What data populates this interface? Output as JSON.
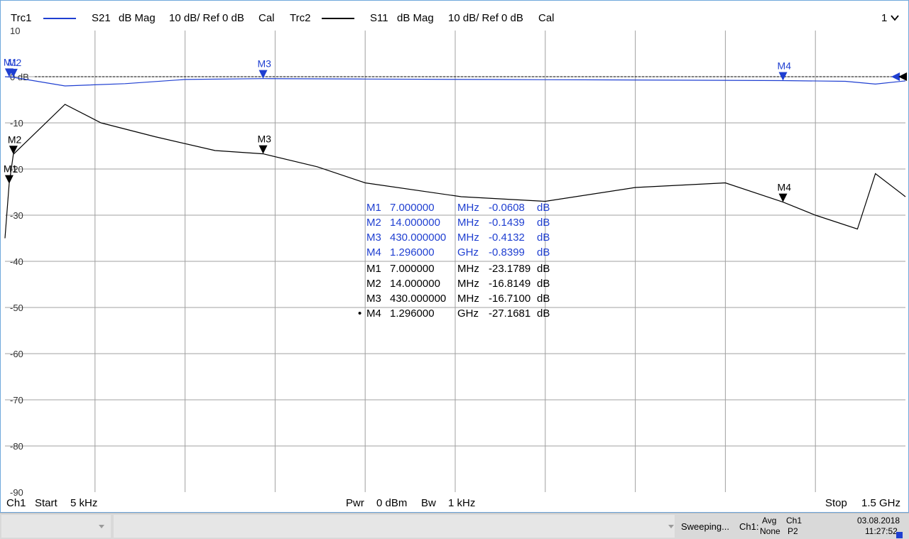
{
  "header": {
    "trc1": {
      "name": "Trc1",
      "param": "S21",
      "format": "dB Mag",
      "scale": "10 dB/ Ref 0 dB",
      "cal": "Cal",
      "color": "#1f3fd1"
    },
    "trc2": {
      "name": "Trc2",
      "param": "S11",
      "format": "dB Mag",
      "scale": "10 dB/ Ref 0 dB",
      "cal": "Cal",
      "color": "#000000"
    },
    "window_number": "1",
    "window_icon": "chevron-down-icon"
  },
  "axis": {
    "y_ticks": [
      "10",
      "0 dB",
      "-10",
      "-20",
      "-30",
      "-40",
      "-50",
      "-60",
      "-70",
      "-80",
      "-90"
    ],
    "y_range": [
      -90,
      10
    ],
    "ref_level": "0 dB"
  },
  "chart_data": {
    "type": "line",
    "x_unit": "Hz",
    "x_range": [
      5000,
      1500000000
    ],
    "y_range": [
      -90,
      10
    ],
    "series": [
      {
        "name": "Trc1",
        "param": "S21",
        "color": "#1f3fd1",
        "x": [
          5000,
          7000000,
          14000000,
          100000000,
          200000000,
          300000000,
          430000000,
          600000000,
          800000000,
          1000000000,
          1296000000,
          1400000000,
          1450000000,
          1500000000
        ],
        "y": [
          0,
          -0.06,
          -0.14,
          -2,
          -1.5,
          -0.6,
          -0.41,
          -0.5,
          -0.6,
          -0.7,
          -0.84,
          -1.0,
          -1.6,
          -0.9
        ]
      },
      {
        "name": "Trc2",
        "param": "S11",
        "color": "#000000",
        "x": [
          5000,
          7000000,
          14000000,
          100000000,
          160000000,
          250000000,
          350000000,
          430000000,
          520000000,
          600000000,
          760000000,
          900000000,
          1050000000,
          1200000000,
          1296000000,
          1350000000,
          1420000000,
          1450000000,
          1500000000
        ],
        "y": [
          -35,
          -23.18,
          -16.81,
          -6,
          -10,
          -13,
          -16,
          -16.71,
          -19.5,
          -23,
          -26,
          -27,
          -24,
          -23,
          -27.17,
          -30,
          -33,
          -21,
          -26
        ]
      }
    ]
  },
  "markers_trc1": [
    {
      "label": "M1",
      "freq": "7.000000",
      "unit": "MHz",
      "value": "-0.0608",
      "vunit": "dB"
    },
    {
      "label": "M2",
      "freq": "14.000000",
      "unit": "MHz",
      "value": "-0.1439",
      "vunit": "dB"
    },
    {
      "label": "M3",
      "freq": "430.000000",
      "unit": "MHz",
      "value": "-0.4132",
      "vunit": "dB"
    },
    {
      "label": "M4",
      "freq": "1.296000",
      "unit": "GHz",
      "value": "-0.8399",
      "vunit": "dB"
    }
  ],
  "markers_trc2": [
    {
      "label": "M1",
      "freq": "7.000000",
      "unit": "MHz",
      "value": "-23.1789",
      "vunit": "dB"
    },
    {
      "label": "M2",
      "freq": "14.000000",
      "unit": "MHz",
      "value": "-16.8149",
      "vunit": "dB"
    },
    {
      "label": "M3",
      "freq": "430.000000",
      "unit": "MHz",
      "value": "-16.7100",
      "vunit": "dB"
    },
    {
      "label": "M4",
      "freq": "1.296000",
      "unit": "GHz",
      "value": "-27.1681",
      "vunit": "dB",
      "active": true
    }
  ],
  "active_marker_symbol": "•",
  "footer": {
    "channel": "Ch1",
    "start_label": "Start",
    "start_value": "5 kHz",
    "pwr_label": "Pwr",
    "pwr_value": "0 dBm",
    "bw_label": "Bw",
    "bw_value": "1 kHz",
    "stop_label": "Stop",
    "stop_value": "1.5 GHz"
  },
  "statusbar": {
    "status": "Sweeping...",
    "channel": "Ch1:",
    "avg": "Avg",
    "avg_value": "None",
    "ch1": "Ch1",
    "port": "P2",
    "date": "03.08.2018",
    "time": "11:27:52"
  }
}
